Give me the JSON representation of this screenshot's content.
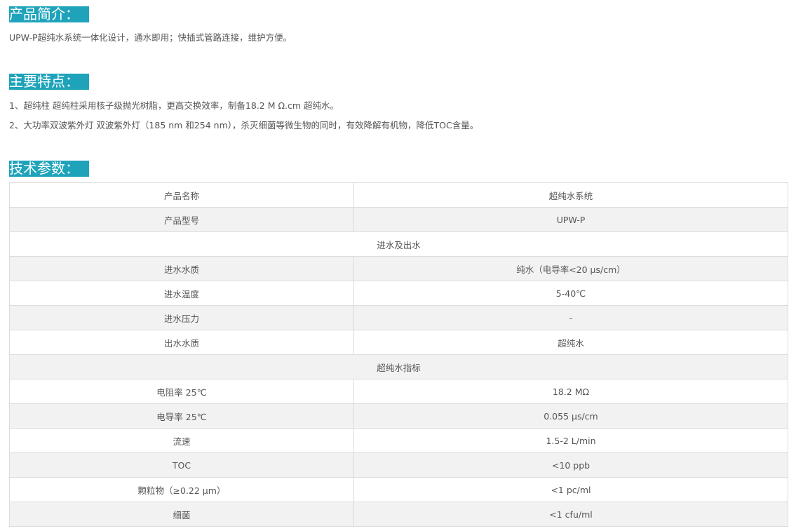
{
  "intro": {
    "heading": "产品简介：",
    "text": "UPW-P超纯水系统一体化设计，通水即用；快插式管路连接，维护方便。"
  },
  "features": {
    "heading": "主要特点：",
    "items": [
      "1、超纯柱 超纯柱采用核子级抛光树脂，更高交换效率，制备18.2 M Ω.cm 超纯水。",
      "2、大功率双波紫外灯 双波紫外灯（185 nm 和254 nm），杀灭细菌等微生物的同时，有效降解有机物，降低TOC含量。"
    ]
  },
  "specs": {
    "heading": "技术参数：",
    "rows": [
      {
        "label": "产品名称",
        "value": "超纯水系统"
      },
      {
        "label": "产品型号",
        "value": "UPW-P"
      },
      {
        "section": "进水及出水"
      },
      {
        "label": "进水水质",
        "value": "纯水（电导率<20 μs/cm）"
      },
      {
        "label": "进水温度",
        "value": "5-40℃"
      },
      {
        "label": "进水压力",
        "value": "-"
      },
      {
        "label": "出水水质",
        "value": "超纯水"
      },
      {
        "section": "超纯水指标"
      },
      {
        "label": "电阻率 25℃",
        "value": "18.2 MΩ"
      },
      {
        "label": "电导率 25℃",
        "value": "0.055 μs/cm"
      },
      {
        "label": "流速",
        "value": "1.5-2 L/min"
      },
      {
        "label": "TOC",
        "value": "<10 ppb"
      },
      {
        "label": "颗粒物（≥0.22 μm）",
        "value": "<1 pc/ml"
      },
      {
        "label": "细菌",
        "value": "<1 cfu/ml"
      }
    ]
  }
}
